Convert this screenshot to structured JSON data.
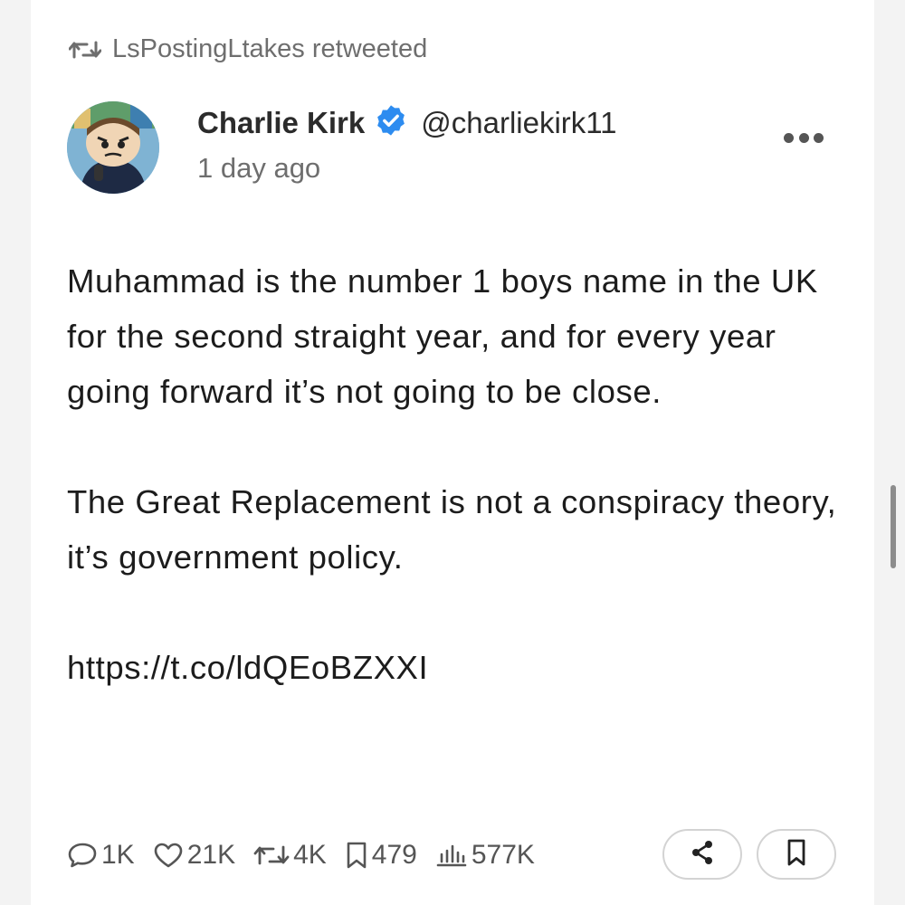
{
  "retweet": {
    "label": "LsPostingLtakes retweeted"
  },
  "author": {
    "name": "Charlie Kirk",
    "handle": "@charliekirk11",
    "verified": true,
    "timestamp": "1 day ago"
  },
  "tweet": {
    "paragraphs": [
      "Muhammad is the number 1 boys name in the UK for the second straight year, and for every year going forward it’s not going to be close.",
      "The Great Replacement is not a conspiracy theory, it’s government policy.",
      "https://t.co/ldQEoBZXXI"
    ]
  },
  "stats": {
    "replies": "1K",
    "likes": "21K",
    "retweets": "4K",
    "bookmarks": "479",
    "views": "577K"
  },
  "icons": {
    "retweet": "retweet-icon",
    "verified": "verified-badge-icon",
    "more": "more-dots-icon",
    "reply": "comment-icon",
    "like": "heart-icon",
    "bookmark": "bookmark-icon",
    "views": "bar-chart-icon",
    "share": "share-icon"
  },
  "colors": {
    "verified": "#2d8cf0",
    "text": "#1c1c1c",
    "muted": "#6e6e6e"
  }
}
